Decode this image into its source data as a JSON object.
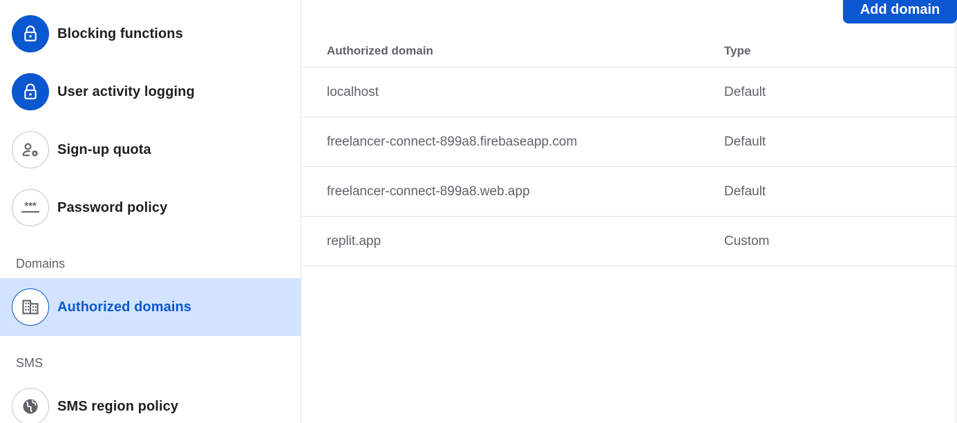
{
  "sidebar": {
    "items": [
      {
        "label": "Blocking functions",
        "icon": "lock-icon"
      },
      {
        "label": "User activity logging",
        "icon": "lock-icon"
      },
      {
        "label": "Sign-up quota",
        "icon": "manage-accounts-icon"
      },
      {
        "label": "Password policy",
        "icon": "password-icon"
      }
    ],
    "sections": {
      "domains": {
        "title": "Domains",
        "items": [
          {
            "label": "Authorized domains",
            "icon": "domain-icon",
            "active": true
          }
        ]
      },
      "sms": {
        "title": "SMS",
        "items": [
          {
            "label": "SMS region policy",
            "icon": "globe-icon"
          }
        ]
      }
    }
  },
  "main": {
    "add_button_label": "Add domain",
    "table": {
      "headers": [
        "Authorized domain",
        "Type"
      ],
      "rows": [
        [
          "localhost",
          "Default"
        ],
        [
          "freelancer-connect-899a8.firebaseapp.com",
          "Default"
        ],
        [
          "freelancer-connect-899a8.web.app",
          "Default"
        ],
        [
          "replit.app",
          "Custom"
        ]
      ]
    }
  },
  "colors": {
    "accent": "#0b57d0",
    "active_bg": "#d3e3fd",
    "text_primary": "#1f1f1f",
    "text_secondary": "#5f6368",
    "divider": "#e0e0e0"
  }
}
